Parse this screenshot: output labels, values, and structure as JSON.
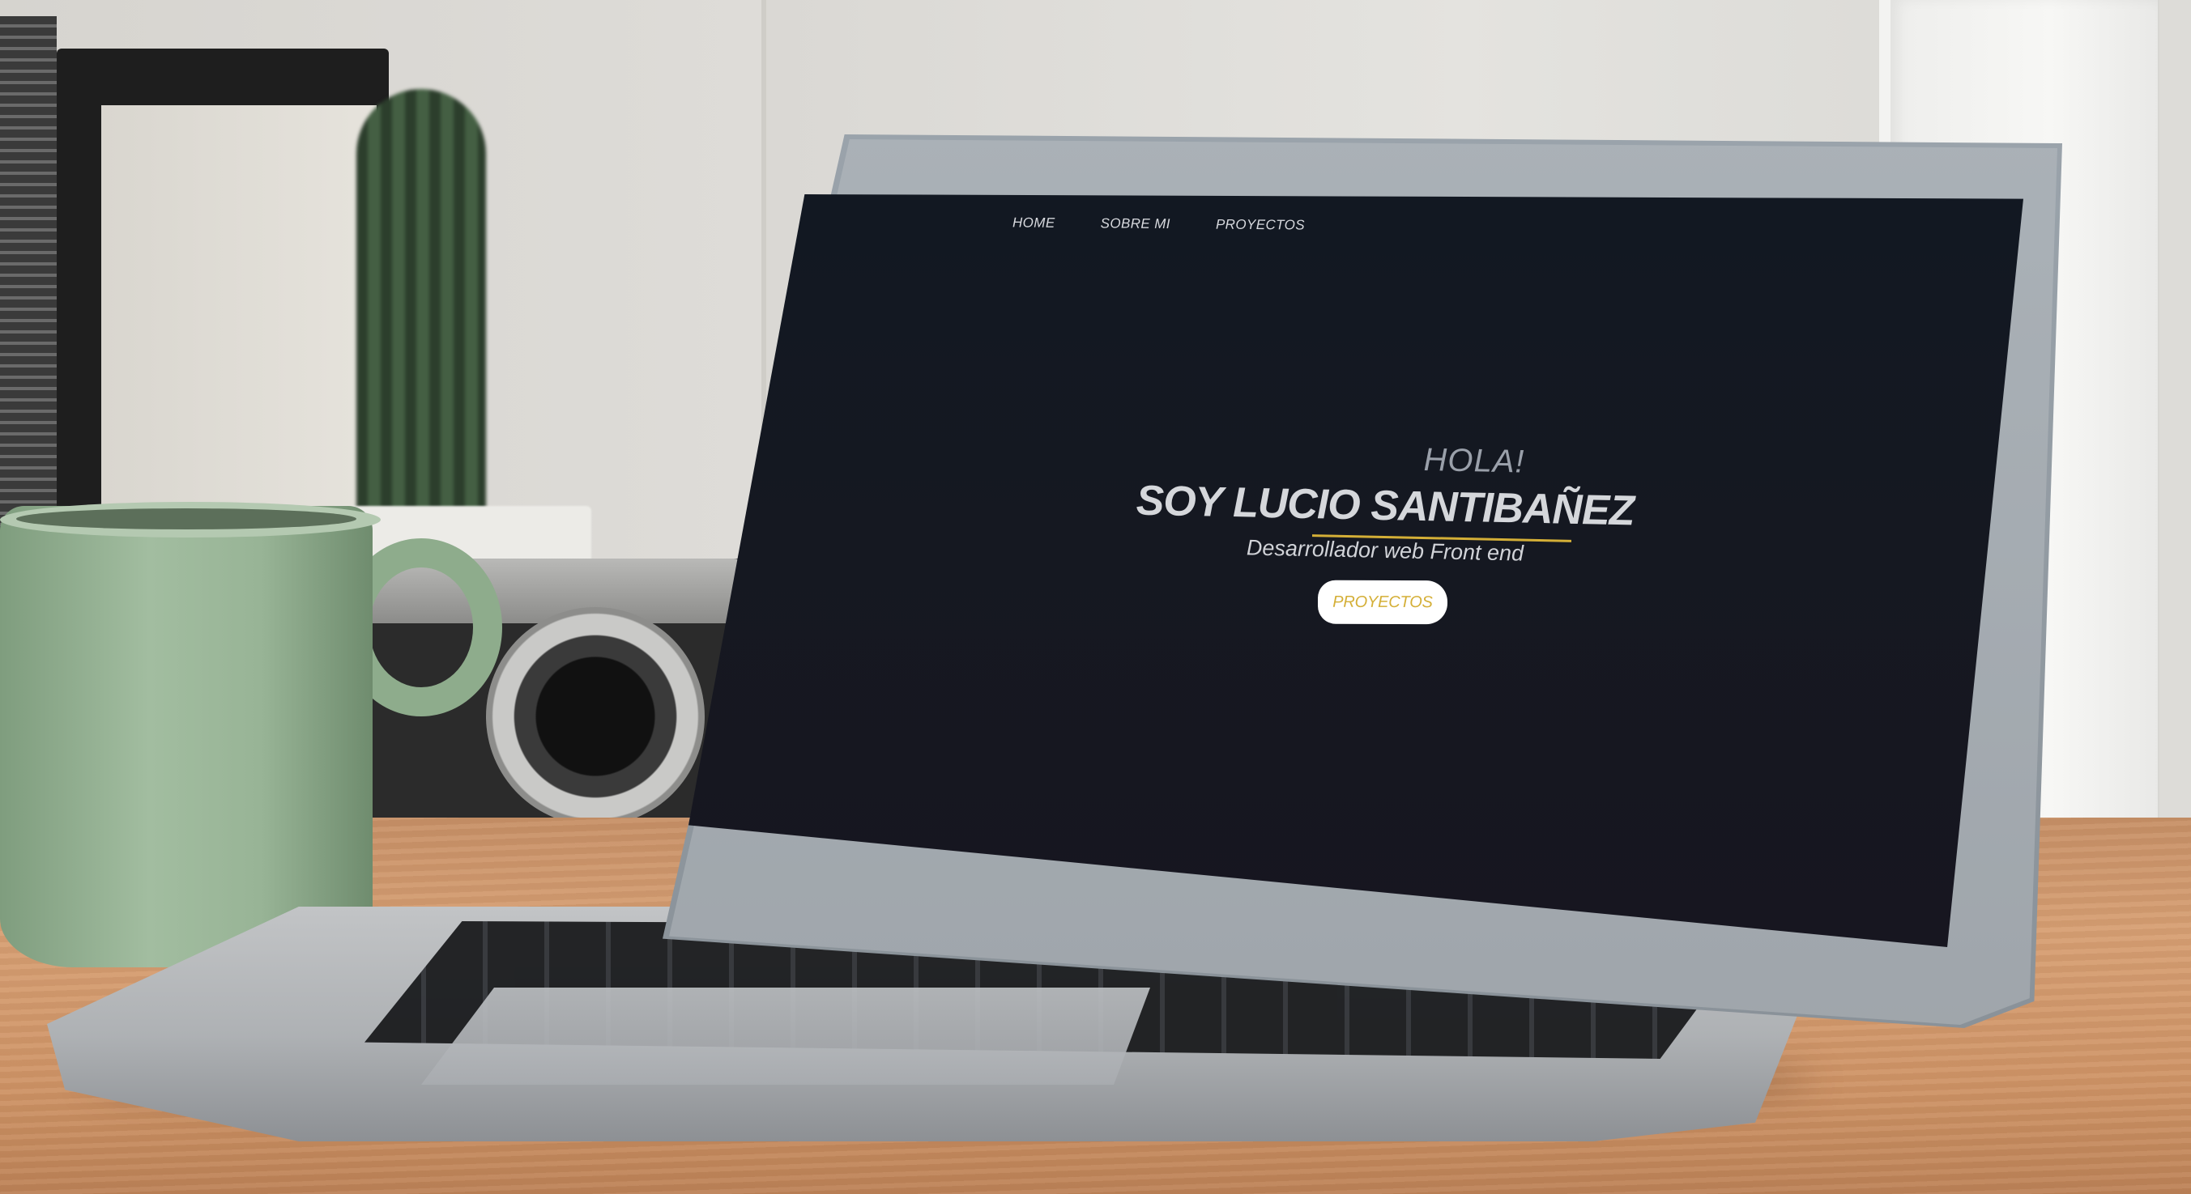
{
  "nav": {
    "items": [
      {
        "label": "HOME"
      },
      {
        "label": "SOBRE MI"
      },
      {
        "label": "PROYECTOS"
      }
    ]
  },
  "hero": {
    "greeting": "HOLA!",
    "name": "SOY LUCIO SANTIBAÑEZ",
    "subtitle": "Desarrollador web Front end",
    "button_label": "PROYECTOS"
  },
  "colors": {
    "screen_background": "#141821",
    "accent": "#d4af37",
    "text": "#d5d7db",
    "button_background": "#ffffff"
  }
}
